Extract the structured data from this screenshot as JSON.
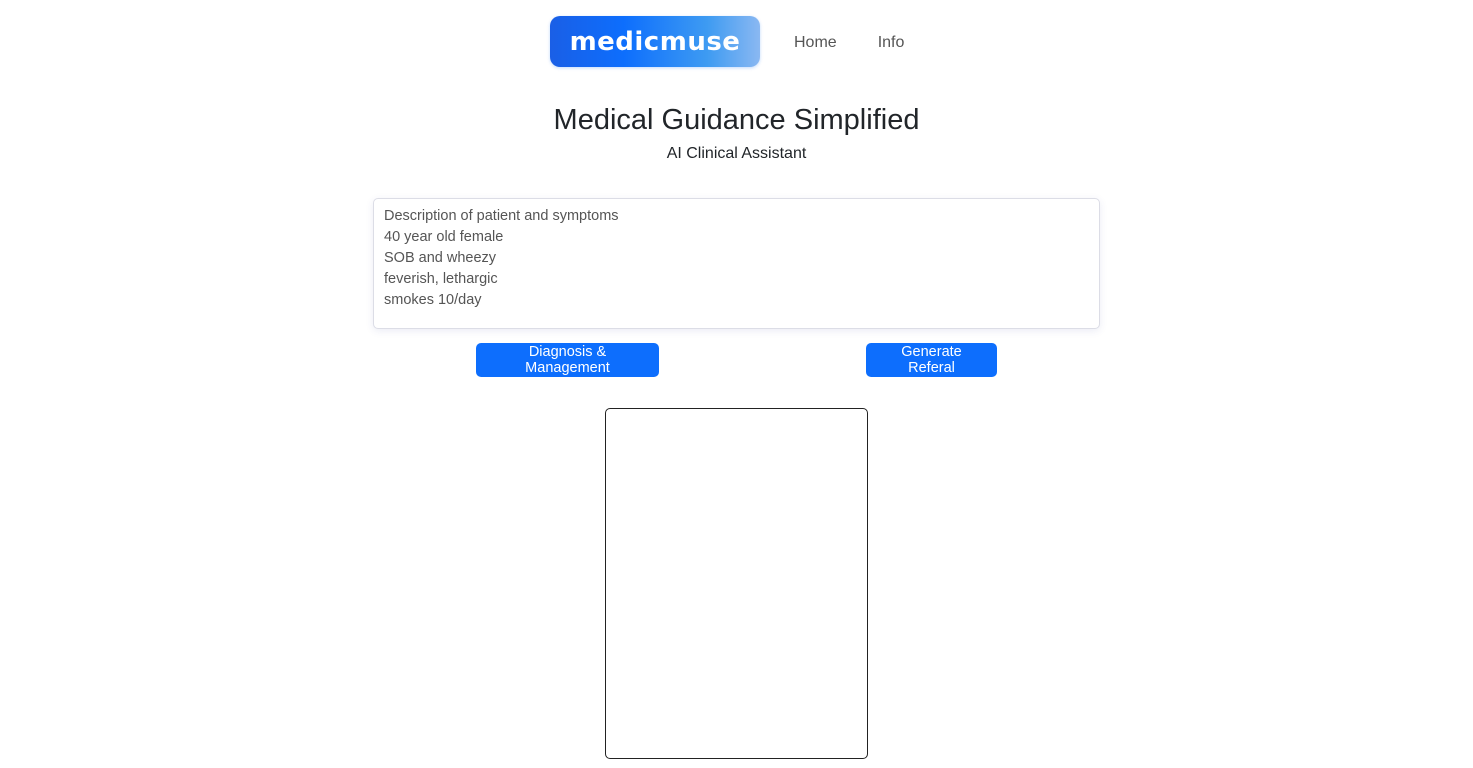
{
  "navbar": {
    "logo_text": "medicmuse",
    "links": [
      {
        "label": "Home"
      },
      {
        "label": "Info"
      }
    ]
  },
  "hero": {
    "title": "Medical Guidance Simplified",
    "subtitle": "AI Clinical Assistant"
  },
  "symptoms": {
    "value": "Description of patient and symptoms\n40 year old female\nSOB and wheezy\nfeverish, lethargic\nsmokes 10/day"
  },
  "actions": {
    "diagnosis_label": "Diagnosis & Management",
    "referral_label": "Generate Referal"
  },
  "colors": {
    "primary": "#0d6efd",
    "text": "#212529",
    "muted_text": "#555555"
  }
}
